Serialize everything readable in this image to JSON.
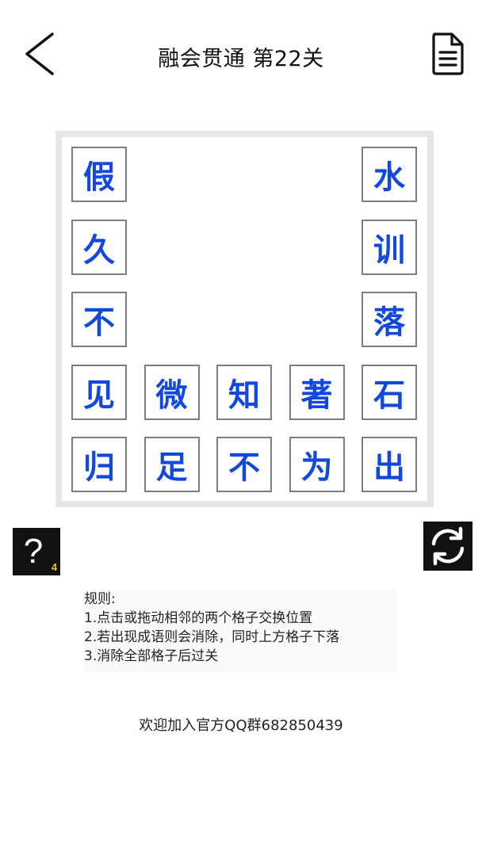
{
  "header": {
    "title": "融会贯通 第22关"
  },
  "board": {
    "tiles": [
      {
        "row": 0,
        "col": 0,
        "char": "假"
      },
      {
        "row": 0,
        "col": 4,
        "char": "水"
      },
      {
        "row": 1,
        "col": 0,
        "char": "久"
      },
      {
        "row": 1,
        "col": 4,
        "char": "训"
      },
      {
        "row": 2,
        "col": 0,
        "char": "不"
      },
      {
        "row": 2,
        "col": 4,
        "char": "落"
      },
      {
        "row": 3,
        "col": 0,
        "char": "见"
      },
      {
        "row": 3,
        "col": 1,
        "char": "微"
      },
      {
        "row": 3,
        "col": 2,
        "char": "知"
      },
      {
        "row": 3,
        "col": 3,
        "char": "著"
      },
      {
        "row": 3,
        "col": 4,
        "char": "石"
      },
      {
        "row": 4,
        "col": 0,
        "char": "归"
      },
      {
        "row": 4,
        "col": 1,
        "char": "足"
      },
      {
        "row": 4,
        "col": 2,
        "char": "不"
      },
      {
        "row": 4,
        "col": 3,
        "char": "为"
      },
      {
        "row": 4,
        "col": 4,
        "char": "出"
      }
    ]
  },
  "hint": {
    "symbol": "?",
    "count": "4"
  },
  "rules": {
    "heading": "规则:",
    "lines": [
      "1.点击或拖动相邻的两个格子交换位置",
      "2.若出现成语则会消除，同时上方格子下落",
      "3.消除全部格子后过关"
    ]
  },
  "footer": {
    "group_text": "欢迎加入官方QQ群682850439"
  },
  "colors": {
    "tile_text": "#1248e0",
    "hint_count": "#f5c400"
  },
  "icons": {
    "back": "chevron-left-icon",
    "doc": "document-icon",
    "refresh": "refresh-icon"
  }
}
